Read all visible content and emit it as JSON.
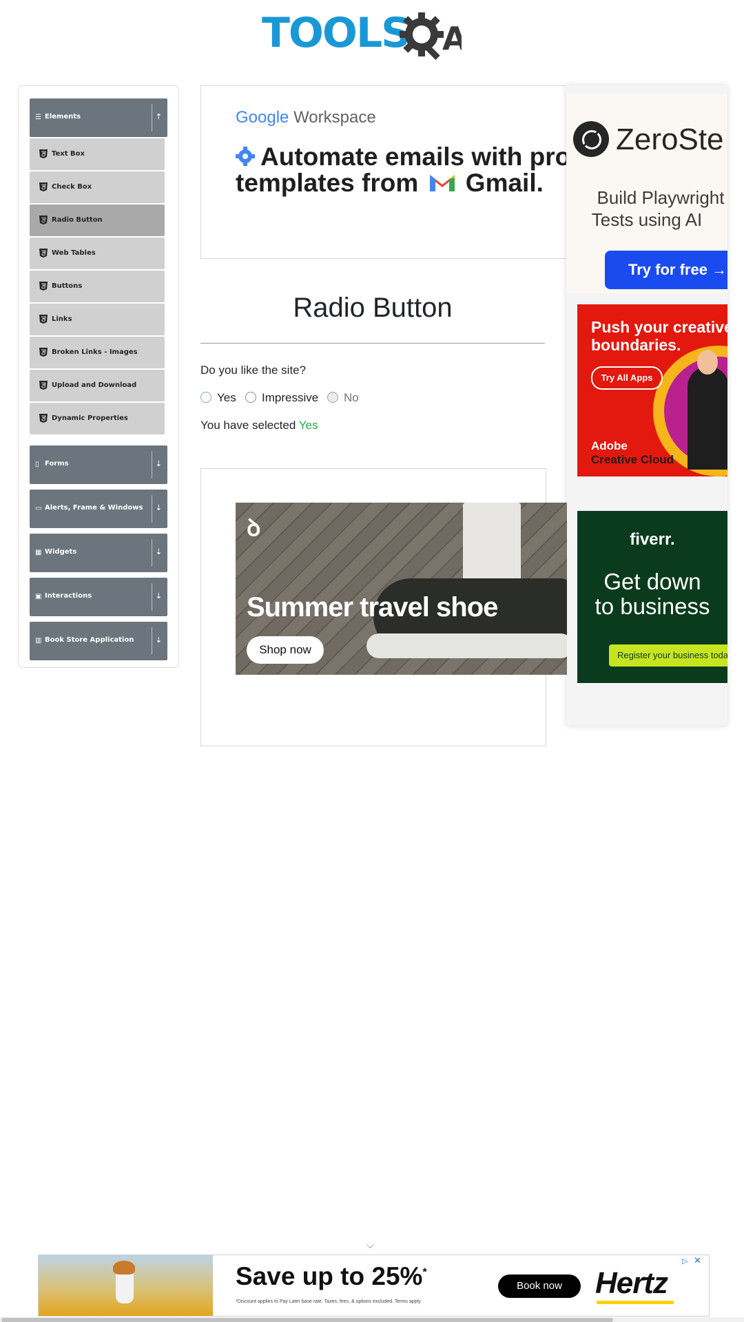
{
  "logo": {
    "text": "TOOLS",
    "suffix": "A"
  },
  "sidebar": {
    "groups": [
      {
        "label": "Elements",
        "icon": "list-icon",
        "arrow": "⇡"
      },
      {
        "label": "Forms",
        "icon": "form-icon",
        "arrow": "⇣"
      },
      {
        "label": "Alerts, Frame & Windows",
        "icon": "window-icon",
        "arrow": "⇣"
      },
      {
        "label": "Widgets",
        "icon": "widgets-icon",
        "arrow": "⇣"
      },
      {
        "label": "Interactions",
        "icon": "interactions-icon",
        "arrow": "⇣"
      },
      {
        "label": "Book Store Application",
        "icon": "bookstore-icon",
        "arrow": "⇣"
      }
    ],
    "items": [
      {
        "label": "Text Box"
      },
      {
        "label": "Check Box"
      },
      {
        "label": "Radio Button",
        "active": true
      },
      {
        "label": "Web Tables"
      },
      {
        "label": "Buttons"
      },
      {
        "label": "Links"
      },
      {
        "label": "Broken Links - Images"
      },
      {
        "label": "Upload and Download"
      },
      {
        "label": "Dynamic Properties"
      }
    ]
  },
  "ads": {
    "workspace": {
      "brand_google": "Google",
      "brand_workspace": "Workspace",
      "headline_line1": "Automate emails with pro",
      "headline_line2_a": "templates from",
      "headline_line2_b": "Gmail."
    },
    "zerostep": {
      "brand": "ZeroSte",
      "tagline_line1": "Build Playwright",
      "tagline_line2": "Tests using AI",
      "cta": "Try for free →"
    },
    "adobe": {
      "headline_line1": "Push your creative",
      "headline_line2": "boundaries.",
      "cta": "Try All Apps",
      "brand_line1": "Adobe",
      "brand_line2": "Creative Cloud"
    },
    "fiverr": {
      "brand": "fiverr.",
      "headline_line1": "Get down",
      "headline_line2": "to business",
      "cta": "Register your business today"
    },
    "on_shoe": {
      "headline": "Summer travel shoe",
      "cta": "Shop now"
    },
    "hertz": {
      "headline": "Save up to 25%",
      "asterisk": "*",
      "disclaimer": "*Discount applies to Pay Later base rate. Taxes, fees, & options excluded. Terms apply.",
      "cta": "Book now",
      "brand": "Hertz"
    }
  },
  "main": {
    "title": "Radio Button",
    "question": "Do you like the site?",
    "options": [
      {
        "label": "Yes"
      },
      {
        "label": "Impressive"
      },
      {
        "label": "No",
        "disabled": true
      }
    ],
    "result_prefix": "You have selected",
    "result_value": "Yes"
  },
  "colors": {
    "brand_blue": "#1a98d6",
    "sidebar_group": "#6c757d",
    "sidebar_item": "#d0d0d0",
    "sidebar_item_active": "#a9a9a9",
    "success": "#28a745"
  }
}
